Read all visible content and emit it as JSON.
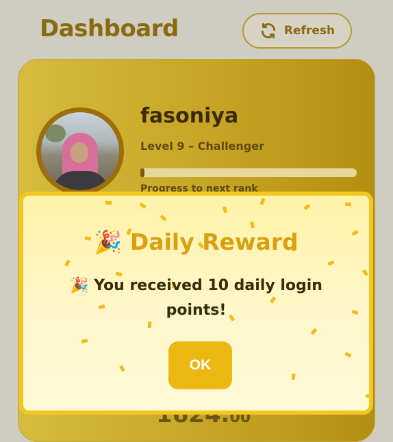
{
  "header": {
    "title": "Dashboard",
    "refresh_label": "Refresh",
    "refresh_icon": "refresh-icon"
  },
  "profile": {
    "username": "fasoniya",
    "level": "Level 9 – Challenger",
    "progress_label": "Progress to next rank",
    "progress_fraction": 0.02,
    "avatar_icon": "profile-photo"
  },
  "balance": {
    "whole": "1624.",
    "cents": "00"
  },
  "modal": {
    "title_emoji": "🎉",
    "title": "Daily Reward",
    "message_emoji": "🎉",
    "message": "You received 10 daily login points!",
    "ok_label": "OK"
  },
  "colors": {
    "accent": "#eab810",
    "title": "#8a6a10",
    "modal_border": "#f2c820"
  }
}
